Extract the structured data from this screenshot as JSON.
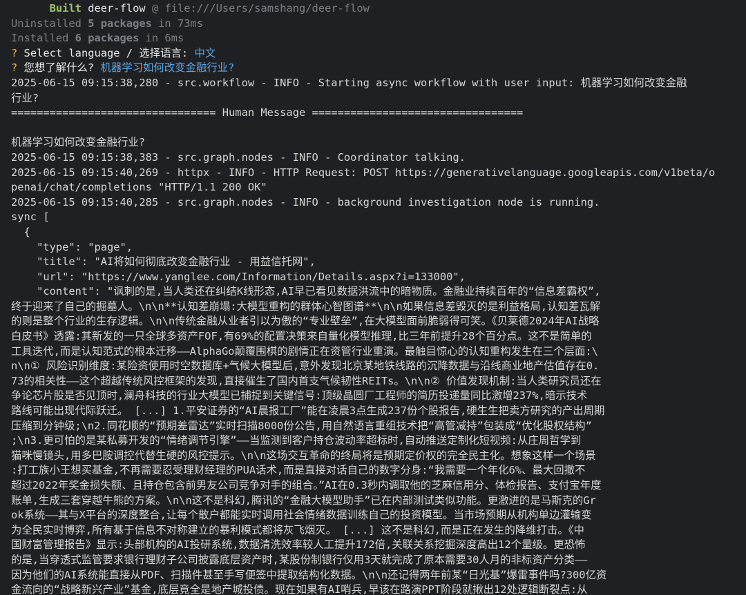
{
  "terminal": {
    "built": {
      "indent": "      ",
      "word": "Built",
      "package": "deer-flow",
      "at": " @ file:///Users/samshang/deer-flow"
    },
    "uninstalled": {
      "pre": "Uninstalled ",
      "count": "5 packages",
      "post": " in 73ms"
    },
    "installed": {
      "pre": "Installed ",
      "count": "6 packages",
      "post": " in 6ms"
    },
    "prompt_language": {
      "mark": "?",
      "question": " Select language / 选择语言: ",
      "answer": "中文"
    },
    "prompt_topic": {
      "mark": "?",
      "question": " 您想了解什么? ",
      "answer": "机器学习如何改变金融行业?"
    },
    "log_lines": [
      "2025-06-15 09:15:38,280 - src.workflow - INFO - Starting async workflow with user input: 机器学习如何改变金融",
      "行业?",
      "================================ Human Message =================================",
      "",
      "机器学习如何改变金融行业?",
      "2025-06-15 09:15:38,383 - src.graph.nodes - INFO - Coordinator talking.",
      "2025-06-15 09:15:40,269 - httpx - INFO - HTTP Request: POST https://generativelanguage.googleapis.com/v1beta/o",
      "penai/chat/completions \"HTTP/1.1 200 OK\"",
      "2025-06-15 09:15:40,285 - src.graph.nodes - INFO - background investigation node is running.",
      "sync [",
      "  {",
      "    \"type\": \"page\",",
      "    \"title\": \"AI将如何彻底改变金融行业 - 用益信托网\",",
      "    \"url\": \"https://www.yanglee.com/Information/Details.aspx?i=133000\",",
      "    \"content\": \"讽刺的是,当人类还在纠结K线形态,AI早已看见数据洪流中的暗物质。金融业持续百年的“信息差霸权”,",
      "终于迎来了自己的掘墓人。\\n\\n**认知差崩塌:大模型重构的群体心智图谱**\\n\\n如果信息差毁灭的是利益格局,认知差瓦解",
      "的则是整个行业的生存逻辑。\\n\\n传统金融从业者引以为傲的“专业壁垒”,在大模型面前脆弱得可笑。《贝莱德2024年AI战略",
      "白皮书》透露:其新发的一只全球多资产FOF,有69%的配置决策来自量化模型推理,比三年前提升28个百分点。这不是简单的",
      "工具迭代,而是认知范式的根本迁移——AlphaGo颠覆围棋的剧情正在资管行业重演。最触目惊心的认知重构发生在三个层面:\\",
      "n\\n① 风险识别维度:某险资使用时空数据库+气候大模型后,意外发现北京某地铁线路的沉降数据与沿线商业地产估值存在0.",
      "73的相关性——这个超越传统风控框架的发现,直接催生了国内首支气候韧性REITs。\\n\\n② 价值发现机制:当人类研究员还在",
      "争论芯片股是否见顶时,澜舟科技的行业大模型已捕捉到关键信号:顶级晶圆厂工程师的简历投递量同比激增237%,暗示技术",
      "路线可能出现代际跃迁。 [...] 1.平安证券的“AI晨报工厂”能在凌晨3点生成237份个股报告,硬生生把卖方研究的产出周期",
      "压缩到分钟级;\\n2.同花顺的“预期差雷达”实时扫描8000份公告,用自然语言重组技术把“高管减持”包装成“优化股权结构”",
      ";\\n3.更可怕的是某私募开发的“情绪调节引擎”——当监测到客户持仓波动率超标时,自动推送定制化短视频:从庄周哲学到",
      "猫咪慢镜头,用多巴胺调控代替生硬的风控提示。\\n\\n这场交互革命的终局将是预期定价权的完全民主化。想象这样一个场景",
      ":打工族小王想买基金,不再需要忍受理财经理的PUA话术,而是直接对话自己的数字分身:“我需要一个年化6%、最大回撤不",
      "超过2022年奖金损失额、且持仓包含前男友公司竞争对手的组合。”AI在0.3秒内调取他的芝麻信用分、体检报告、支付宝年度",
      "账单,生成三套穿越牛熊的方案。\\n\\n这不是科幻,腾讯的“金融大模型助手”已在内部测试类似功能。更激进的是马斯克的Gr",
      "ok系统——其与X平台的深度整合,让每个散户都能实时调用社会情绪数据训练自己的投资模型。当市场预期从机构单边灌输变",
      "为全民实时博弈,所有基于信息不对称建立的暴利模式都将灰飞烟灭。 [...] 这不是科幻,而是正在发生的降维打击。《中",
      "国财富管理报告》显示:头部机构的AI投研系统,数据清洗效率较人工提升172倍,关联关系挖掘深度高出12个量级。更恐怖",
      "的是,当穿透式监管要求银行理财子公司披露底层资产时,某股份制银行仅用3天就完成了原本需要30人月的非标资产分类——",
      "因为他们的AI系统能直接从PDF、扫描件甚至手写便签中提取结构化数据。\\n\\n还记得两年前某“日光基”爆雷事件吗?300亿资",
      "金流向的“战略新兴产业”基金,底层竟全是地产城投债。现在如果有AI哨兵,早该在路演PPT阶段就揪出12处逻辑断裂点:从"
    ]
  }
}
